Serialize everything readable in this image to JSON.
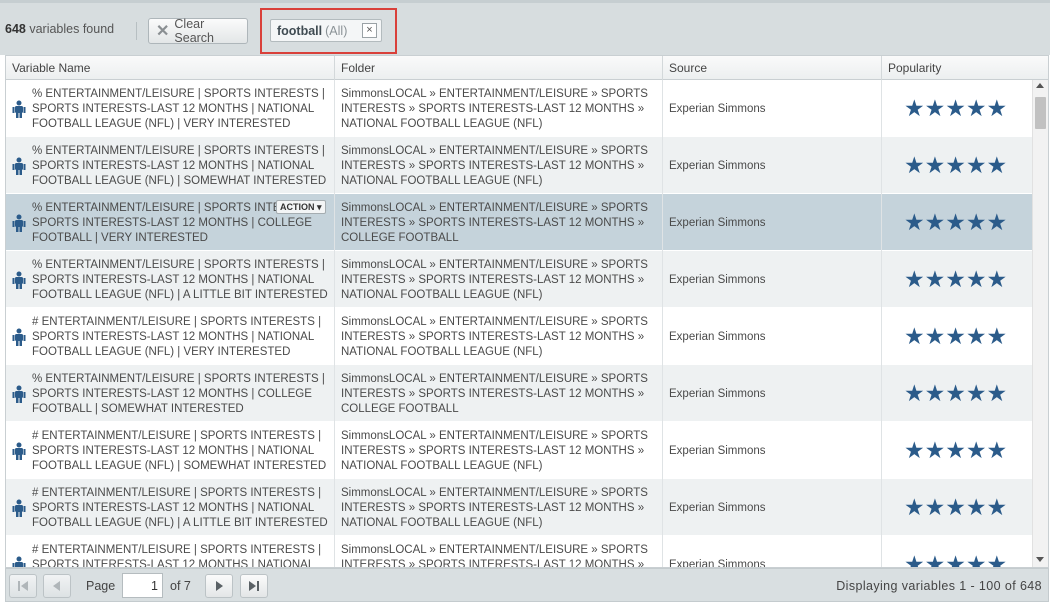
{
  "toolbar": {
    "count": "648",
    "count_label": " variables found",
    "clear_label": "Clear Search",
    "search_tag": {
      "term": "football",
      "scope": "(All)",
      "remove": "×"
    }
  },
  "columns": [
    "Variable Name",
    "Folder",
    "Source",
    "Popularity"
  ],
  "rows": [
    {
      "name": "% ENTERTAINMENT/LEISURE | SPORTS INTERESTS | SPORTS INTERESTS-LAST 12 MONTHS | NATIONAL FOOTBALL LEAGUE (NFL) | VERY INTERESTED",
      "folder": "SimmonsLOCAL » ENTERTAINMENT/LEISURE » SPORTS INTERESTS » SPORTS INTERESTS-LAST 12 MONTHS » NATIONAL FOOTBALL LEAGUE (NFL)",
      "source": "Experian Simmons",
      "stars": "★★★★★"
    },
    {
      "name": "% ENTERTAINMENT/LEISURE | SPORTS INTERESTS | SPORTS INTERESTS-LAST 12 MONTHS | NATIONAL FOOTBALL LEAGUE (NFL) | SOMEWHAT INTERESTED",
      "folder": "SimmonsLOCAL » ENTERTAINMENT/LEISURE » SPORTS INTERESTS » SPORTS INTERESTS-LAST 12 MONTHS » NATIONAL FOOTBALL LEAGUE (NFL)",
      "source": "Experian Simmons",
      "stars": "★★★★★"
    },
    {
      "name": "% ENTERTAINMENT/LEISURE | SPORTS INTERESTS | SPORTS INTERESTS-LAST 12 MONTHS | COLLEGE FOOTBALL | VERY INTERESTED",
      "folder": "SimmonsLOCAL » ENTERTAINMENT/LEISURE » SPORTS INTERESTS » SPORTS INTERESTS-LAST 12 MONTHS » COLLEGE FOOTBALL",
      "source": "Experian Simmons",
      "stars": "★★★★★",
      "action": "ACTION ▾"
    },
    {
      "name": "% ENTERTAINMENT/LEISURE | SPORTS INTERESTS | SPORTS INTERESTS-LAST 12 MONTHS | NATIONAL FOOTBALL LEAGUE (NFL) | A LITTLE BIT INTERESTED",
      "folder": "SimmonsLOCAL » ENTERTAINMENT/LEISURE » SPORTS INTERESTS » SPORTS INTERESTS-LAST 12 MONTHS » NATIONAL FOOTBALL LEAGUE (NFL)",
      "source": "Experian Simmons",
      "stars": "★★★★★"
    },
    {
      "name": "# ENTERTAINMENT/LEISURE | SPORTS INTERESTS | SPORTS INTERESTS-LAST 12 MONTHS | NATIONAL FOOTBALL LEAGUE (NFL) | VERY INTERESTED",
      "folder": "SimmonsLOCAL » ENTERTAINMENT/LEISURE » SPORTS INTERESTS » SPORTS INTERESTS-LAST 12 MONTHS » NATIONAL FOOTBALL LEAGUE (NFL)",
      "source": "Experian Simmons",
      "stars": "★★★★★"
    },
    {
      "name": "% ENTERTAINMENT/LEISURE | SPORTS INTERESTS | SPORTS INTERESTS-LAST 12 MONTHS | COLLEGE FOOTBALL | SOMEWHAT INTERESTED",
      "folder": "SimmonsLOCAL » ENTERTAINMENT/LEISURE » SPORTS INTERESTS » SPORTS INTERESTS-LAST 12 MONTHS » COLLEGE FOOTBALL",
      "source": "Experian Simmons",
      "stars": "★★★★★"
    },
    {
      "name": "# ENTERTAINMENT/LEISURE | SPORTS INTERESTS | SPORTS INTERESTS-LAST 12 MONTHS | NATIONAL FOOTBALL LEAGUE (NFL) | SOMEWHAT INTERESTED",
      "folder": "SimmonsLOCAL » ENTERTAINMENT/LEISURE » SPORTS INTERESTS » SPORTS INTERESTS-LAST 12 MONTHS » NATIONAL FOOTBALL LEAGUE (NFL)",
      "source": "Experian Simmons",
      "stars": "★★★★★"
    },
    {
      "name": "# ENTERTAINMENT/LEISURE | SPORTS INTERESTS | SPORTS INTERESTS-LAST 12 MONTHS | NATIONAL FOOTBALL LEAGUE (NFL) | A LITTLE BIT INTERESTED",
      "folder": "SimmonsLOCAL » ENTERTAINMENT/LEISURE » SPORTS INTERESTS » SPORTS INTERESTS-LAST 12 MONTHS » NATIONAL FOOTBALL LEAGUE (NFL)",
      "source": "Experian Simmons",
      "stars": "★★★★★"
    },
    {
      "name": "# ENTERTAINMENT/LEISURE | SPORTS INTERESTS | SPORTS INTERESTS-LAST 12 MONTHS | NATIONAL FOOTBALL",
      "folder": "SimmonsLOCAL » ENTERTAINMENT/LEISURE » SPORTS INTERESTS » SPORTS INTERESTS-LAST 12 MONTHS » NATIONAL",
      "source": "Experian Simmons",
      "stars": "★★★★★"
    }
  ],
  "pager": {
    "page_label": "Page",
    "page_value": "1",
    "of_label": "of 7",
    "display": "Displaying variables 1 - 100 of 648"
  },
  "colors": {
    "star": "#2b5b8a",
    "selected_row": "#c5d3db",
    "highlight_border": "#d9403a"
  }
}
